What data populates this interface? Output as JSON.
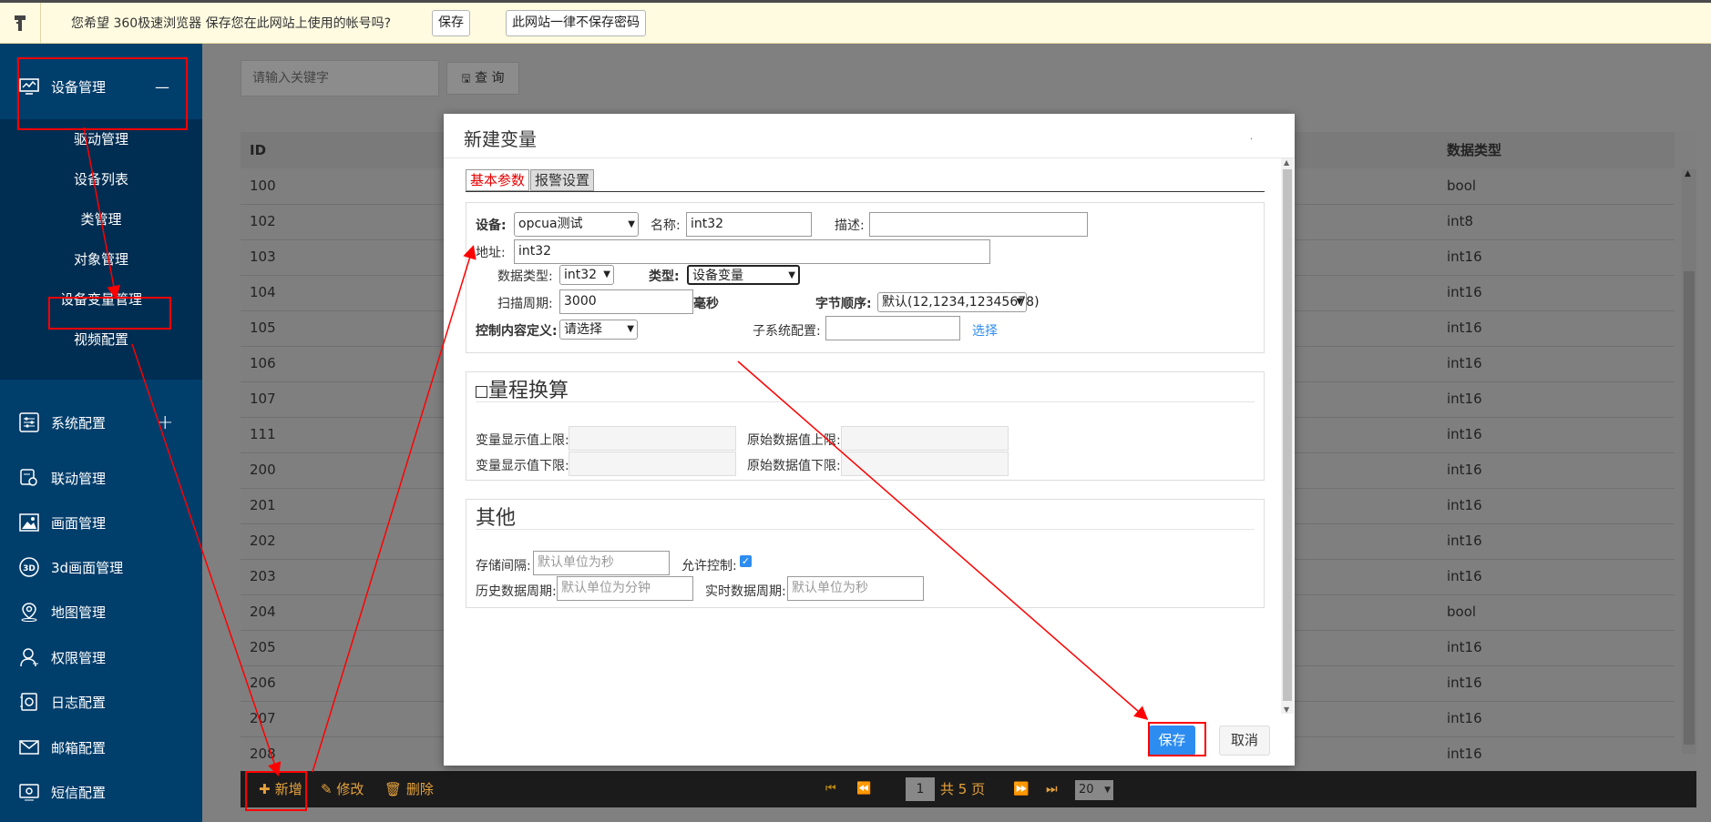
{
  "browser_bar": {
    "message": "您希望 360极速浏览器 保存您在此网站上使用的帐号吗?",
    "save_label": "保存",
    "never_label": "此网站一律不保存密码"
  },
  "sidebar": {
    "group_device": "设备管理",
    "group_device_toggle": "—",
    "sub_items": [
      "驱动管理",
      "设备列表",
      "类管理",
      "对象管理",
      "设备变量管理",
      "视频配置"
    ],
    "items": [
      {
        "label": "系统配置",
        "icon": "sliders-icon",
        "toggle": "+"
      },
      {
        "label": "联动管理",
        "icon": "link-icon"
      },
      {
        "label": "画面管理",
        "icon": "image-icon"
      },
      {
        "label": "3d画面管理",
        "icon": "3d-icon"
      },
      {
        "label": "地图管理",
        "icon": "map-pin-icon"
      },
      {
        "label": "权限管理",
        "icon": "user-icon"
      },
      {
        "label": "日志配置",
        "icon": "log-icon"
      },
      {
        "label": "邮箱配置",
        "icon": "mail-icon"
      },
      {
        "label": "短信配置",
        "icon": "sms-icon"
      }
    ]
  },
  "search": {
    "placeholder": "请输入关键字",
    "button_label": "查 询"
  },
  "table": {
    "col_id": "ID",
    "col_type": "数据类型",
    "rows": [
      {
        "id": "100",
        "type": "bool"
      },
      {
        "id": "102",
        "type": "int8"
      },
      {
        "id": "103",
        "type": "int16"
      },
      {
        "id": "104",
        "type": "int16"
      },
      {
        "id": "105",
        "type": "int16"
      },
      {
        "id": "106",
        "type": "int16"
      },
      {
        "id": "107",
        "type": "int16"
      },
      {
        "id": "111",
        "type": "int16"
      },
      {
        "id": "200",
        "type": "int16"
      },
      {
        "id": "201",
        "type": "int16"
      },
      {
        "id": "202",
        "type": "int16"
      },
      {
        "id": "203",
        "type": "int16"
      },
      {
        "id": "204",
        "type": "bool"
      },
      {
        "id": "205",
        "type": "int16"
      },
      {
        "id": "206",
        "type": "int16"
      },
      {
        "id": "207",
        "type": "int16"
      },
      {
        "id": "208",
        "type": "int16"
      }
    ]
  },
  "footer": {
    "add_label": "新增",
    "edit_label": "修改",
    "delete_label": "删除",
    "page_value": "1",
    "total_pages": "共 5 页",
    "page_size": "20"
  },
  "dialog": {
    "title": "新建变量",
    "tab_basic": "基本参数",
    "tab_alarm": "报警设置",
    "basic": {
      "device_label": "设备:",
      "device_value": "opcua测试",
      "name_label": "名称:",
      "name_value": "int32",
      "desc_label": "描述:",
      "desc_value": "",
      "address_label": "地址:",
      "address_value": "int32",
      "datatype_label": "数据类型:",
      "datatype_value": "int32",
      "type_label": "类型:",
      "type_value": "设备变量",
      "scan_label": "扫描周期:",
      "scan_value": "3000",
      "scan_unit": "毫秒",
      "byteorder_label": "字节顺序:",
      "byteorder_value": "默认(12,1234,12345678)",
      "control_label": "控制内容定义:",
      "control_value": "请选择",
      "subsystem_label": "子系统配置:",
      "subsystem_value": "",
      "select_link": "选择"
    },
    "range": {
      "legend": "量程换算",
      "display_upper_label": "变量显示值上限:",
      "raw_upper_label": "原始数据值上限:",
      "display_lower_label": "变量显示值下限:",
      "raw_lower_label": "原始数据值下限:"
    },
    "other": {
      "legend": "其他",
      "storage_label": "存储间隔:",
      "storage_placeholder": "默认单位为秒",
      "allow_control_label": "允许控制:",
      "history_label": "历史数据周期:",
      "history_placeholder": "默认单位为分钟",
      "realtime_label": "实时数据周期:",
      "realtime_placeholder": "默认单位为秒"
    },
    "save_label": "保存",
    "cancel_label": "取消"
  },
  "colors": {
    "sidebar_bg": "#003e6c",
    "primary": "#2d8cf0",
    "annotation": "#ff0000",
    "footer_accent": "#e6a23c"
  }
}
